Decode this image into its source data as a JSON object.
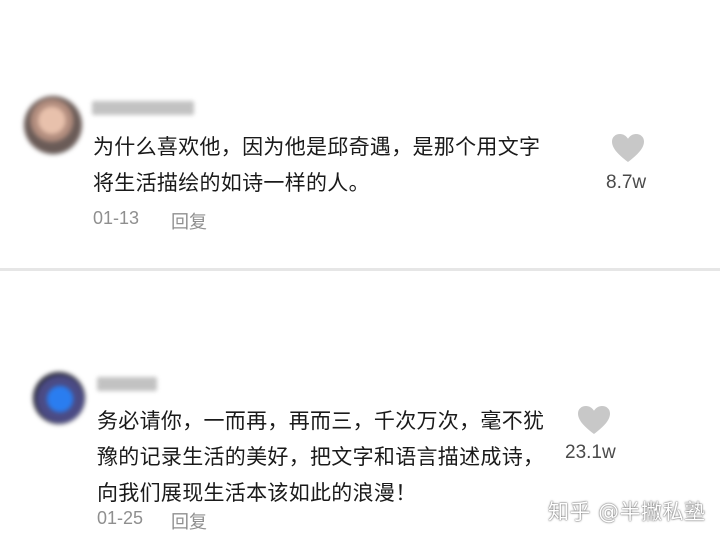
{
  "comments": [
    {
      "text_lines": [
        "为什么喜欢他，因为他是邱奇遇，是那个用文字",
        "将生活描绘的如诗一样的人。"
      ],
      "date": "01-13",
      "reply_label": "回复",
      "like_count": "8.7w"
    },
    {
      "text_lines": [
        "务必请你，一而再，再而三，千次万次，毫不犹",
        "豫的记录生活的美好，把文字和语言描述成诗，",
        "向我们展现生活本该如此的浪漫！"
      ],
      "date": "01-25",
      "reply_label": "回复",
      "like_count": "23.1w"
    }
  ],
  "watermark": "知乎 @半撇私塾",
  "colors": {
    "text": "#1a1a1a",
    "meta": "#8f8f8f",
    "like_icon": "#c8c8c8",
    "divider": "#e6e6e6"
  },
  "icons": {
    "like": "heart-icon"
  }
}
